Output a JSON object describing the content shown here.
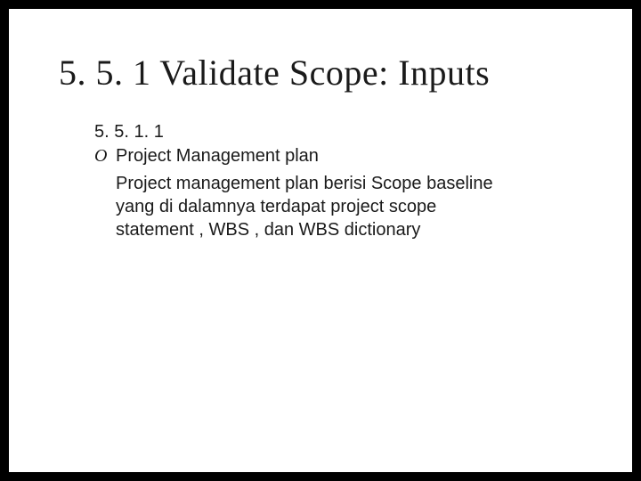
{
  "title": "5. 5. 1 Validate Scope: Inputs",
  "subsection": "5. 5. 1. 1",
  "bullet_marker": "O",
  "bullet_label": "Project Management plan",
  "body": "Project management plan berisi Scope baseline yang di dalamnya terdapat project scope statement , WBS , dan WBS dictionary"
}
